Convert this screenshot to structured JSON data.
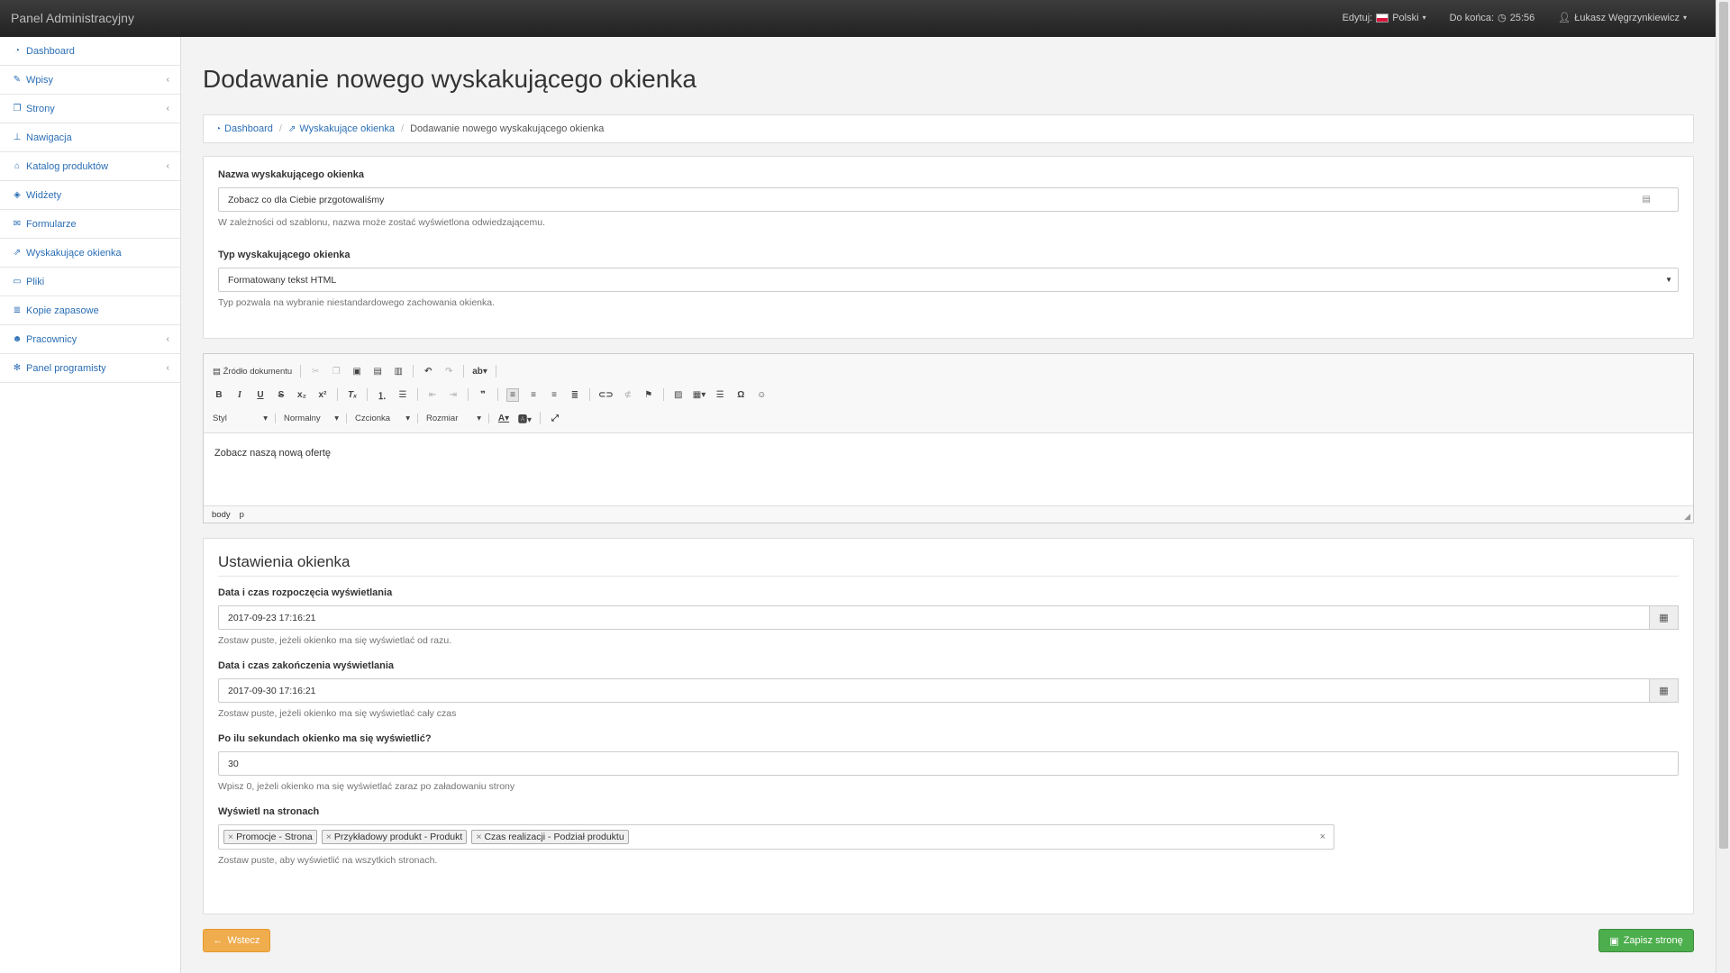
{
  "app": {
    "title": "Panel Administracyjny",
    "edit_label": "Edytuj:",
    "language": "Polski",
    "countdown_label": "Do końca:",
    "countdown_value": "25:56",
    "user_name": "Łukasz Węgrzynkiewicz"
  },
  "sidebar": {
    "items": [
      {
        "label": "Dashboard",
        "icon": "dashboard-icon",
        "submenu": false
      },
      {
        "label": "Wpisy",
        "icon": "edit-icon",
        "submenu": true
      },
      {
        "label": "Strony",
        "icon": "copy-icon",
        "submenu": true
      },
      {
        "label": "Nawigacja",
        "icon": "sitemap-icon",
        "submenu": false
      },
      {
        "label": "Katalog produktów",
        "icon": "bank-icon",
        "submenu": true
      },
      {
        "label": "Widżety",
        "icon": "cube-icon",
        "submenu": false
      },
      {
        "label": "Formularze",
        "icon": "envelope-icon",
        "submenu": false
      },
      {
        "label": "Wyskakujące okienka",
        "icon": "external-link-icon",
        "submenu": false
      },
      {
        "label": "Pliki",
        "icon": "folder-icon",
        "submenu": false
      },
      {
        "label": "Kopie zapasowe",
        "icon": "database-icon",
        "submenu": false
      },
      {
        "label": "Pracownicy",
        "icon": "users-icon",
        "submenu": true
      },
      {
        "label": "Panel programisty",
        "icon": "gear-icon",
        "submenu": true
      }
    ]
  },
  "page": {
    "title": "Dodawanie nowego wyskakującego okienka",
    "breadcrumb": [
      "Dashboard",
      "Wyskakujące okienka",
      "Dodawanie nowego wyskakującego okienka"
    ]
  },
  "form": {
    "name_label": "Nazwa wyskakującego okienka",
    "name_value": "Zobacz co dla Ciebie przgotowaliśmy",
    "name_help": "W zależności od szablonu, nazwa może zostać wyświetlona odwiedzającemu.",
    "type_label": "Typ wyskakującego okienka",
    "type_value": "Formatowany tekst HTML",
    "type_help": "Typ pozwala na wybranie niestandardowego zachowania okienka."
  },
  "editor": {
    "source_label": "Źródło dokumentu",
    "style_label": "Styl",
    "format_label": "Normalny",
    "font_label": "Czcionka",
    "size_label": "Rozmiar",
    "content": "Zobacz naszą nową ofertę",
    "path": [
      "body",
      "p"
    ]
  },
  "settings": {
    "heading": "Ustawienia okienka",
    "start_label": "Data i czas rozpoczęcia wyświetlania",
    "start_value": "2017-09-23 17:16:21",
    "start_help": "Zostaw puste, jeżeli okienko ma się wyświetlać od razu.",
    "end_label": "Data i czas zakończenia wyświetlania",
    "end_value": "2017-09-30 17:16:21",
    "end_help": "Zostaw puste, jeżeli okienko ma się wyświetlać cały czas",
    "delay_label": "Po ilu sekundach okienko ma się wyświetlić?",
    "delay_value": "30",
    "delay_help": "Wpisz 0, jeżeli okienko ma się wyświetlać zaraz po załadowaniu strony",
    "pages_label": "Wyświetl na stronach",
    "pages": [
      "Promocje - Strona",
      "Przykładowy produkt - Produkt",
      "Czas realizacji - Podział produktu"
    ],
    "pages_help": "Zostaw puste, aby wyświetlić na wszytkich stronach."
  },
  "actions": {
    "back_label": "Wstecz",
    "save_label": "Zapisz stronę"
  },
  "colors": {
    "link": "#2a6eb5",
    "back_button": "#f0ad4e",
    "save_button": "#4cae4c",
    "topbar": "#2b2b2b"
  }
}
